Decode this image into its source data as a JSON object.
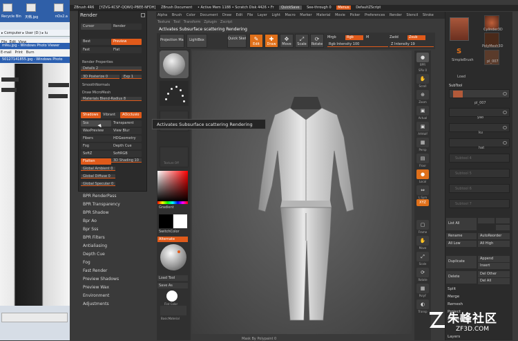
{
  "desktop": {
    "icons": [
      {
        "label": "Recycle Bin"
      },
      {
        "label": "天韩.jpg"
      },
      {
        "label": "nOx2.a"
      }
    ],
    "address": "▸ Computer ▸ User (D:) ▸ lu",
    "menu": [
      "File",
      "Edit",
      "View"
    ],
    "windows": [
      {
        "title": "mlku.jpg - Windows Photo Viewer"
      },
      {
        "title": "50127141855.jpg - Windows Photo"
      }
    ],
    "menu2": [
      "E-mail",
      "Print",
      "Burn"
    ]
  },
  "titlebar": {
    "app": "ZBrush 4R6",
    "doc": "[YZVG-KCSF-QQWQ-PBEE-NFDH]",
    "document": "ZBrush Document",
    "memory": "• Active Mem 1188 • Scratch Disk 4426 • Fr",
    "quicksave": "QuickSave",
    "seethrough": "See-through  0",
    "menus": "Menus",
    "script": "DefaultZScript"
  },
  "menubar": [
    "Alpha",
    "Brush",
    "Color",
    "Document",
    "Draw",
    "Edit",
    "File",
    "Layer",
    "Light",
    "Macro",
    "Marker",
    "Material",
    "Movie",
    "Picker",
    "Preferences",
    "Render",
    "Stencil",
    "Stroke"
  ],
  "menubar2": [
    "Texture",
    "Tool",
    "Transform",
    "Zplugin",
    "Zscript"
  ],
  "status": "Activates Subsurface scattering Rendering",
  "render_panel": {
    "title": "Render",
    "cursor": "Cursor",
    "render": "Render",
    "best": "Best",
    "preview": "Preview",
    "fast": "Fast",
    "flat": "Flat",
    "properties": "Render Properties",
    "details": "Details 2",
    "posterize": "3D Posterize 0",
    "exp": "Exp 1",
    "smooth_normals": "SmoothNormals",
    "draw_micromesh": "Draw MicroMesh",
    "materials_blend": "Materials Blend-Radius 8",
    "shadows": "Shadows",
    "vibrant": "Vibrant",
    "aocclusion": "AOcclusio",
    "sss": "Sss",
    "transparent": "Transparent",
    "waxpreview": "WaxPreview",
    "view_blur": "View Blur",
    "fibers": "Fibers",
    "hdgeometry": "HDGeometry",
    "fog": "Fog",
    "depth_cue": "Depth Cue",
    "softz": "SoftZ",
    "softrgb": "SoftRGB",
    "flatten": "Flatten",
    "shading": "3D Shading 10",
    "global_ambient": "Global Ambient 0",
    "global_diffuse": "Global Diffuse 0",
    "global_specular": "Global Specular 0"
  },
  "render_list": [
    "BPR RenderPass",
    "BPR Transparency",
    "BPR Shadow",
    "Bpr Ao",
    "Bpr Sss",
    "BPR Filters",
    "Antialiasing",
    "Depth Cue",
    "Fog",
    "Fast Render",
    "Preview Shadows",
    "Preview Wax",
    "Environment",
    "Adjustments"
  ],
  "toolcol": {
    "gradient": "Gradient",
    "switchcolor": "SwitchColor",
    "alternate": "Alternate",
    "load_tool": "Load Tool",
    "save_as": "Save As",
    "flat_color": "Flat Color",
    "basicmaterial": "BasicMaterial",
    "tile_labels": [
      "Alpha Off",
      "Texture Off"
    ]
  },
  "toptools": {
    "projection_master": "Projection Master",
    "lightbox": "LightBox",
    "quick_sketch": "Quick Sketch",
    "edit": "Edit",
    "draw": "Draw",
    "move": "Move",
    "scale": "Scale",
    "rotate": "Rotate",
    "mrgb": "Mrgb",
    "rgb": "Rgb",
    "m": "M",
    "rgb_intensity": "Rgb Intensity 100",
    "zadd": "Zadd",
    "zsub": "Zsub",
    "z_intensity": "Z Intensity 19"
  },
  "tooltip": "Activates Subsurface scattering Rendering",
  "right_strip": [
    {
      "label": "BPR",
      "icon": "●"
    },
    {
      "label": "SPix 0",
      "icon": ""
    },
    {
      "label": "Scroll",
      "icon": "✋"
    },
    {
      "label": "Zoom",
      "icon": "⊕"
    },
    {
      "label": "Actual",
      "icon": "▣"
    },
    {
      "label": "AAHalf",
      "icon": "▣"
    },
    {
      "label": "Persp",
      "icon": "▦"
    },
    {
      "label": "Floor",
      "icon": "▤"
    },
    {
      "label": "Local",
      "icon": "●"
    },
    {
      "label": "L.Sym",
      "icon": "⇔"
    },
    {
      "label": "XYZ",
      "icon": "⟳"
    },
    {
      "label": "Frame",
      "icon": "▢"
    },
    {
      "label": "Move",
      "icon": "✋"
    },
    {
      "label": "Scale",
      "icon": "⤢"
    },
    {
      "label": "Rotate",
      "icon": "⟳"
    },
    {
      "label": "PolyF",
      "icon": "▦"
    },
    {
      "label": "Transp",
      "icon": "◐"
    }
  ],
  "right_panel": {
    "cylinder": "Cylinder3D",
    "polymesh": "PolyMesh3D",
    "simplebrush": "SimpleBrush",
    "sub_name": "pl_007",
    "load": "Load",
    "subtool": "SubTool",
    "subtool_items": [
      "pl_007",
      "yao",
      "ku",
      "hat",
      "Subtool 4",
      "Subtool 5",
      "Subtool 6",
      "Subtool 7"
    ],
    "list_all": "List All",
    "rename": "Rename",
    "autoreorder": "AutoReorder",
    "all_low": "All Low",
    "all_high": "All High",
    "duplicate": "Duplicate",
    "append": "Append",
    "insert": "Insert",
    "delete": "Delete",
    "del_other": "Del Other",
    "del_all": "Del All",
    "split": "Split",
    "merge": "Merge",
    "remesh": "Remesh",
    "project": "Project",
    "extract": "Extract",
    "layers": "Layers"
  },
  "watermark": {
    "text": "朱峰社区",
    "sub": "ZF3D.COM"
  },
  "bottom_status": "Mask By Polypaint 0"
}
